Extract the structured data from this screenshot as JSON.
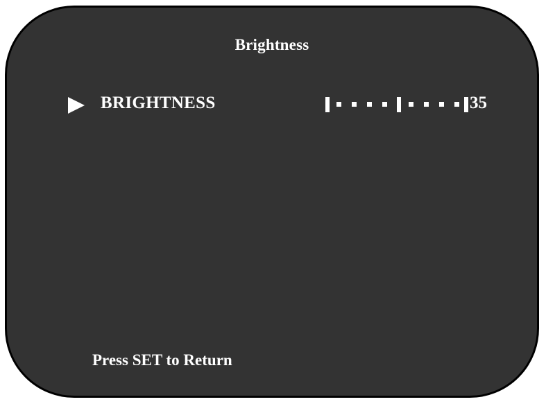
{
  "screen": {
    "title": "Brightness",
    "footer_hint": "Press SET to Return"
  },
  "menu": {
    "selected_pointer_icon": "play-arrow-icon",
    "item": {
      "label": "BRIGHTNESS",
      "value": "35"
    }
  },
  "colors": {
    "panel_background": "#333333",
    "panel_border": "#000000",
    "text": "#ffffff"
  }
}
